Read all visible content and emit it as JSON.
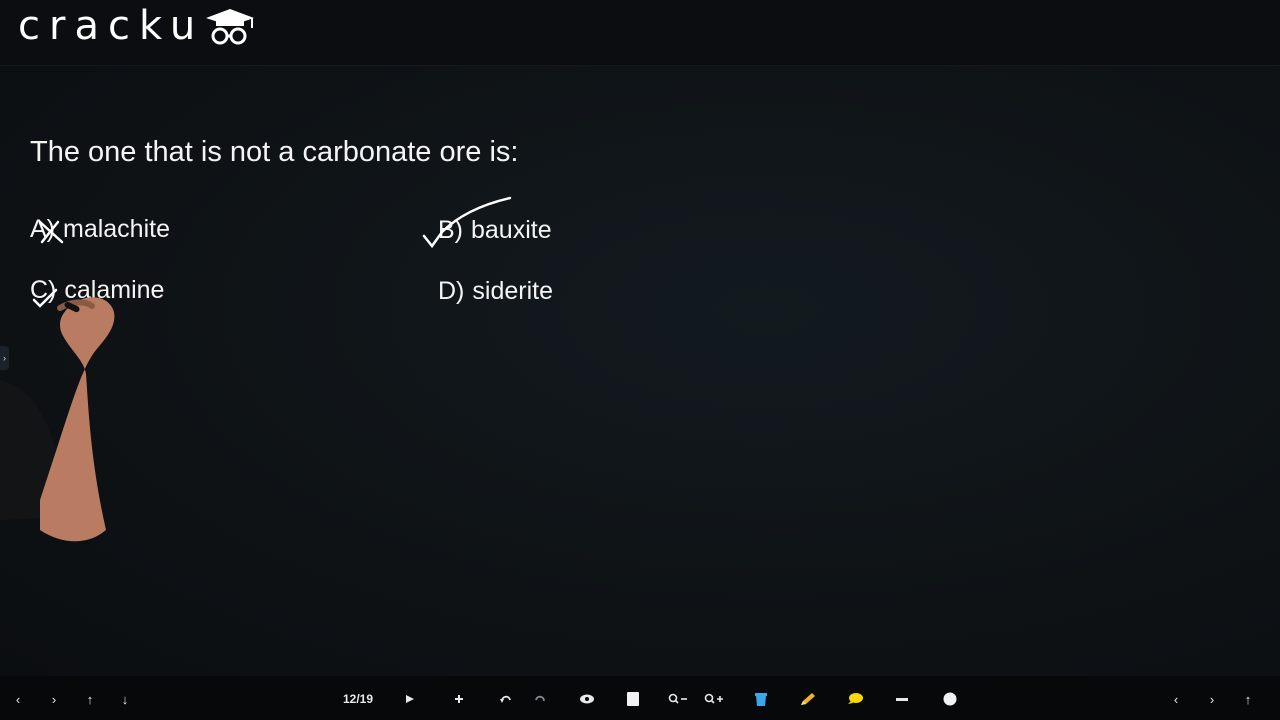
{
  "header": {
    "logo_text": "cracku"
  },
  "question": {
    "text": "The one that is not a carbonate ore is:",
    "options": [
      {
        "letter": "A)",
        "text": "malachite"
      },
      {
        "letter": "B)",
        "text": "bauxite"
      },
      {
        "letter": "C)",
        "text": "calamine"
      },
      {
        "letter": "D)",
        "text": "siderite"
      }
    ]
  },
  "sidebar": {
    "toggle_glyph": "›"
  },
  "toolbar": {
    "page_indicator": "12/19",
    "left_glyphs": [
      "‹",
      "›",
      "↑",
      "↓"
    ],
    "right_glyphs": [
      "‹",
      "›",
      "↑"
    ],
    "icons": [
      "play-icon",
      "plus-icon",
      "undo-icon",
      "redo-icon",
      "eye-icon",
      "page-icon",
      "zoom-out-icon",
      "zoom-in-icon",
      "trash-icon",
      "pen-icon",
      "highlighter-icon",
      "line-icon",
      "dot-icon"
    ]
  },
  "colors": {
    "background": "#0d1013",
    "header": "#0b0d10",
    "toolbar": "#070809",
    "text": "#f4f4f4",
    "pen_trash": "#3aa7e6",
    "pen_pencil": "#f0b429",
    "pen_highlighter": "#f5d90a"
  }
}
